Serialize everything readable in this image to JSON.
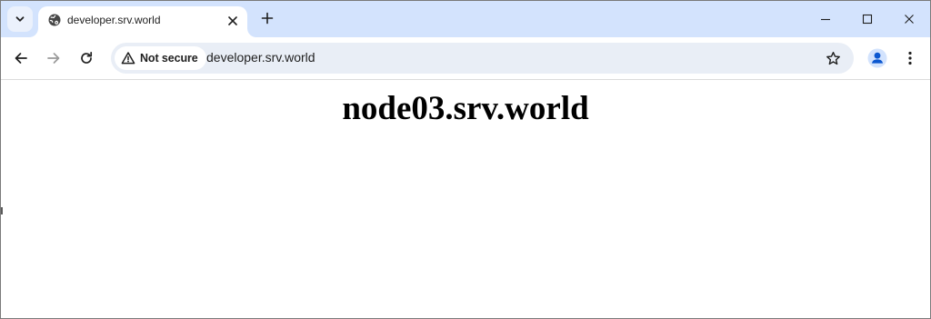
{
  "browser": {
    "tab": {
      "title": "developer.srv.world",
      "favicon": "globe-icon"
    },
    "new_tab_icon": "plus-icon",
    "window_controls": [
      "minimize-icon",
      "maximize-icon",
      "close-icon"
    ]
  },
  "toolbar": {
    "back_icon": "arrow-left-icon",
    "forward_icon": "arrow-right-icon",
    "reload_icon": "reload-icon",
    "security": {
      "label": "Not secure",
      "icon": "warning-icon"
    },
    "url": "developer.srv.world",
    "bookmark_icon": "star-icon",
    "profile_icon": "person-icon",
    "menu_icon": "kebab-menu-icon"
  },
  "page": {
    "heading": "node03.srv.world"
  },
  "colors": {
    "tabstrip_bg": "#d3e3fd",
    "omnibox_bg": "#e9eef6",
    "profile_accent": "#0b57d0",
    "text": "#1f1f1f"
  }
}
